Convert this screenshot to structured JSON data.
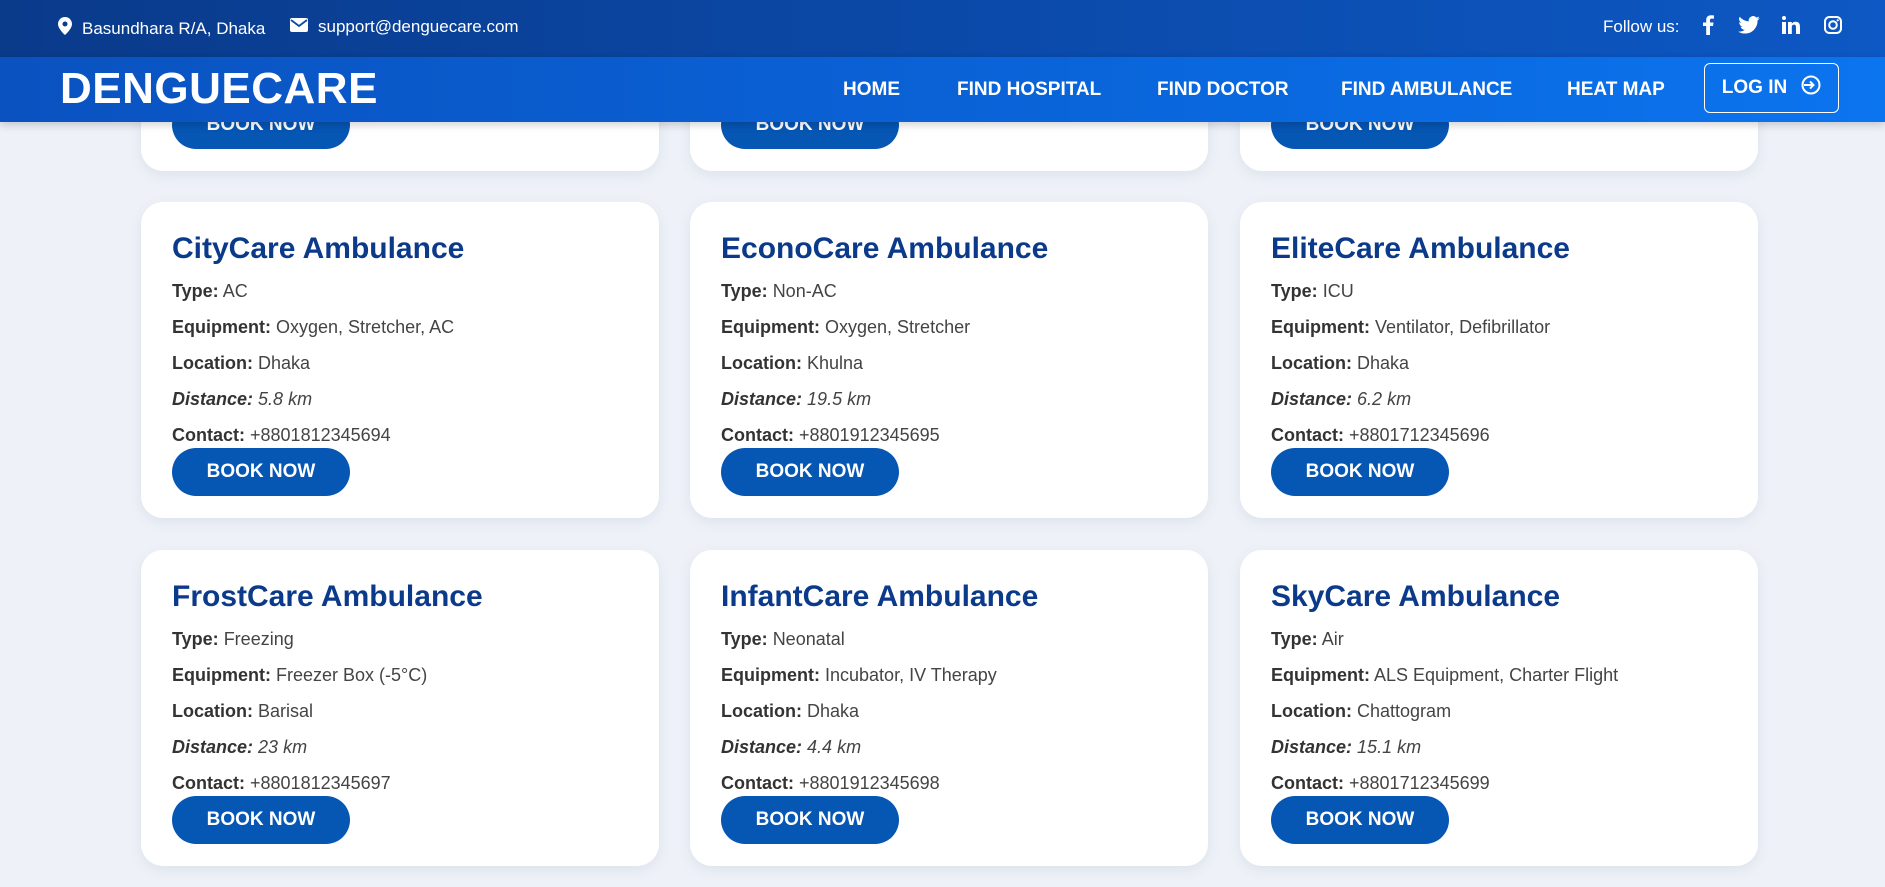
{
  "topbar": {
    "location": "Basundhara R/A, Dhaka",
    "email": "support@denguecare.com",
    "follow_label": "Follow us:",
    "social_icons": [
      "facebook-icon",
      "twitter-icon",
      "linkedin-icon",
      "instagram-icon"
    ]
  },
  "nav": {
    "brand": "DENGUECARE",
    "links": [
      "HOME",
      "FIND HOSPITAL",
      "FIND DOCTOR",
      "FIND AMBULANCE",
      "HEAT MAP"
    ],
    "login": "LOG IN"
  },
  "labels": {
    "type": "Type:",
    "equipment": "Equipment:",
    "location": "Location:",
    "distance": "Distance:",
    "contact": "Contact:",
    "book": "BOOK NOW"
  },
  "cards": [
    {
      "name": "CityCare Ambulance",
      "type": "AC",
      "equipment": "Oxygen, Stretcher, AC",
      "location": "Dhaka",
      "distance": "5.8 km",
      "contact": "+8801812345694"
    },
    {
      "name": "EconoCare Ambulance",
      "type": "Non-AC",
      "equipment": "Oxygen, Stretcher",
      "location": "Khulna",
      "distance": "19.5 km",
      "contact": "+8801912345695"
    },
    {
      "name": "EliteCare Ambulance",
      "type": "ICU",
      "equipment": "Ventilator, Defibrillator",
      "location": "Dhaka",
      "distance": "6.2 km",
      "contact": "+8801712345696"
    },
    {
      "name": "FrostCare Ambulance",
      "type": "Freezing",
      "equipment": "Freezer Box (-5°C)",
      "location": "Barisal",
      "distance": "23 km",
      "contact": "+8801812345697"
    },
    {
      "name": "InfantCare Ambulance",
      "type": "Neonatal",
      "equipment": "Incubator, IV Therapy",
      "location": "Dhaka",
      "distance": "4.4 km",
      "contact": "+8801912345698"
    },
    {
      "name": "SkyCare Ambulance",
      "type": "Air",
      "equipment": "ALS Equipment, Charter Flight",
      "location": "Chattogram",
      "distance": "15.1 km",
      "contact": "+8801712345699"
    }
  ],
  "colors": {
    "primary": "#0656b4",
    "heading": "#0b3a8a",
    "topbar": "#0a3a8a",
    "background": "#eef2f8"
  }
}
